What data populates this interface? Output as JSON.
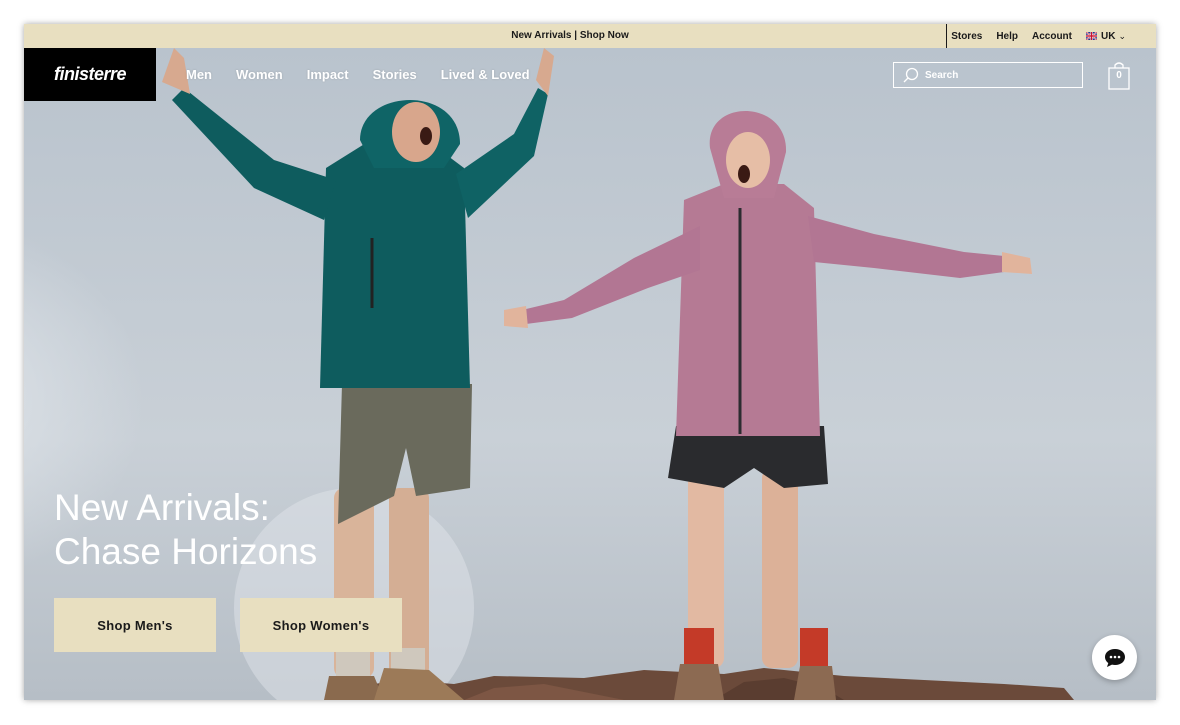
{
  "promo": {
    "text": "New Arrivals | Shop Now"
  },
  "utility": {
    "stores": "Stores",
    "help": "Help",
    "account": "Account",
    "region": "UK"
  },
  "header": {
    "logo": "finisterre",
    "nav": [
      "Men",
      "Women",
      "Impact",
      "Stories",
      "Lived & Loved"
    ],
    "search_placeholder": "Search",
    "cart_count": "0"
  },
  "hero": {
    "headline_line1": "New Arrivals:",
    "headline_line2": "Chase Horizons",
    "shop_men": "Shop Men's",
    "shop_women": "Shop Women's"
  },
  "colors": {
    "accent": "#e8dfc0",
    "logo_bg": "#000000",
    "sky": "#c5ccd4"
  },
  "icons": [
    "uk-flag-icon",
    "chevron-down-icon",
    "search-icon",
    "shopping-bag-icon",
    "chat-icon"
  ]
}
